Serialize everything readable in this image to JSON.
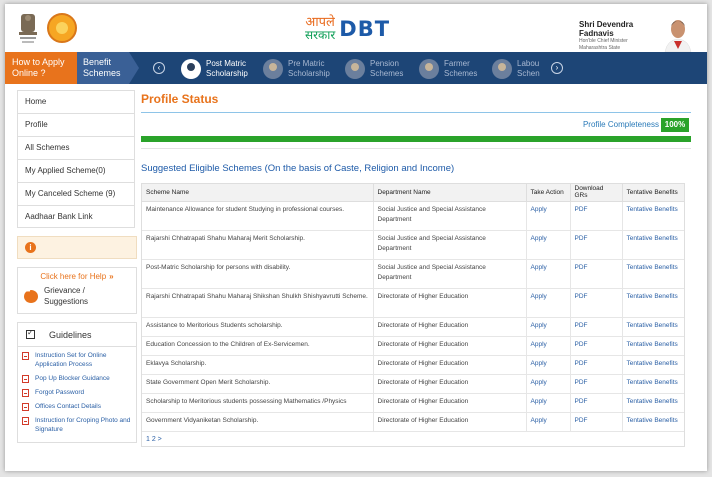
{
  "header": {
    "logo_marathi_top": "आपले",
    "logo_marathi_bottom": "सरकार",
    "logo_text": "DBT",
    "cm_name": "Shri Devendra Fadnavis",
    "cm_title": "Hon'ble Chief Minister",
    "cm_state": "Maharashtra State"
  },
  "nav": {
    "apply_label": "How to Apply Online ?",
    "benefit_label": "Benefit Schemes",
    "prev": "‹",
    "next": "›",
    "items": [
      {
        "label": "Post Matric Scholarship",
        "active": true
      },
      {
        "label": "Pre Matric Scholarship",
        "active": false
      },
      {
        "label": "Pension Schemes",
        "active": false
      },
      {
        "label": "Farmer Schemes",
        "active": false
      },
      {
        "label": "Labou Schen",
        "active": false
      }
    ]
  },
  "sidebar": {
    "links": [
      "Home",
      "Profile",
      "All Schemes",
      "My Applied Scheme(0)",
      "My Canceled Scheme (9)",
      "Aadhaar Bank Link"
    ],
    "info_icon": "i",
    "help_label": "Click here for Help",
    "help_chevron": "»",
    "grievance_label": "Grievance / Suggestions",
    "guidelines_label": "Guidelines",
    "guide_links": [
      "Instruction Set for Online Application Process",
      "Pop Up Blocker Guidance",
      "Forgot Password",
      "Offices Contact Details",
      "Instruction for Croping Photo and Signature"
    ]
  },
  "main": {
    "profile_title": "Profile Status",
    "completeness_label": "Profile Completeness",
    "completeness_pct": "100%",
    "completeness_fraction": 1.0,
    "suggested_title": "Suggested Eligible Schemes (On the basis of Caste, Religion and Income)",
    "columns": [
      "Scheme Name",
      "Department Name",
      "Take Action",
      "Download GRs",
      "Tentative Benefits"
    ],
    "rows": [
      [
        "Maintenance Allowance for student Studying in professional courses.",
        "Social Justice and Special Assistance Department",
        "Apply",
        "PDF",
        "Tentative Benefits"
      ],
      [
        "Rajarshi Chhatrapati Shahu Maharaj Merit Scholarship.",
        "Social Justice and Special Assistance Department",
        "Apply",
        "PDF",
        "Tentative Benefits"
      ],
      [
        "Post-Matric Scholarship for persons with disability.",
        "Social Justice and Special Assistance Department",
        "Apply",
        "PDF",
        "Tentative Benefits"
      ],
      [
        "Rajarshi Chhatrapati Shahu Maharaj Shikshan Shulkh Shishyavrutti Scheme.",
        "Directorate of Higher Education",
        "Apply",
        "PDF",
        "Tentative Benefits"
      ],
      [
        "Assistance to Meritorious Students scholarship.",
        "Directorate of Higher Education",
        "Apply",
        "PDF",
        "Tentative Benefits"
      ],
      [
        "Education Concession to the Children of Ex-Servicemen.",
        "Directorate of Higher Education",
        "Apply",
        "PDF",
        "Tentative Benefits"
      ],
      [
        "Eklavya Scholarship.",
        "Directorate of Higher Education",
        "Apply",
        "PDF",
        "Tentative Benefits"
      ],
      [
        "State Government Open Merit Scholarship.",
        "Directorate of Higher Education",
        "Apply",
        "PDF",
        "Tentative Benefits"
      ],
      [
        "Scholarship to Meritorious students possessing Mathematics /Physics",
        "Directorate of Higher Education",
        "Apply",
        "PDF",
        "Tentative Benefits"
      ],
      [
        "Government Vidyaniketan Scholarship.",
        "Directorate of Higher Education",
        "Apply",
        "PDF",
        "Tentative Benefits"
      ]
    ],
    "pager": "1 2 >"
  }
}
